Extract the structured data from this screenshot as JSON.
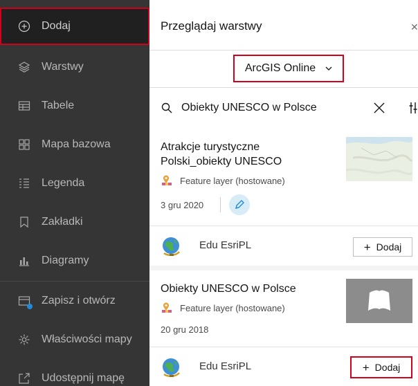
{
  "sidebar": {
    "items": [
      {
        "label": "Dodaj",
        "icon": "add-circle-icon",
        "active": true
      },
      {
        "label": "Warstwy",
        "icon": "layers-icon"
      },
      {
        "label": "Tabele",
        "icon": "table-icon"
      },
      {
        "label": "Mapa bazowa",
        "icon": "basemap-icon"
      },
      {
        "label": "Legenda",
        "icon": "legend-icon"
      },
      {
        "label": "Zakładki",
        "icon": "bookmark-icon"
      },
      {
        "label": "Diagramy",
        "icon": "chart-icon"
      },
      {
        "label": "Zapisz i otwórz",
        "icon": "save-icon"
      },
      {
        "label": "Właściwości mapy",
        "icon": "gear-icon"
      },
      {
        "label": "Udostępnij mapę",
        "icon": "share-icon"
      }
    ]
  },
  "panel": {
    "title": "Przeglądaj warstwy",
    "close_icon": "close-icon",
    "source": "ArcGIS Online",
    "search": {
      "value": "Obiekty UNESCO w Polsce",
      "placeholder": ""
    }
  },
  "results": [
    {
      "title_line1": "Atrakcje turystyczne",
      "title_line2": "Polski_obiekty UNESCO",
      "type": "Feature layer (hostowane)",
      "date": "3 gru 2020",
      "owner": "Edu EsriPL",
      "add_label": "Dodaj"
    },
    {
      "title_line1": "Obiekty UNESCO w Polsce",
      "type": "Feature layer (hostowane)",
      "date": "20 gru 2018",
      "owner": "Edu EsriPL",
      "add_label": "Dodaj"
    }
  ],
  "colors": {
    "sidebar_bg": "#353535",
    "highlight": "#d0021b",
    "accent_blue": "#1f8bd8"
  }
}
